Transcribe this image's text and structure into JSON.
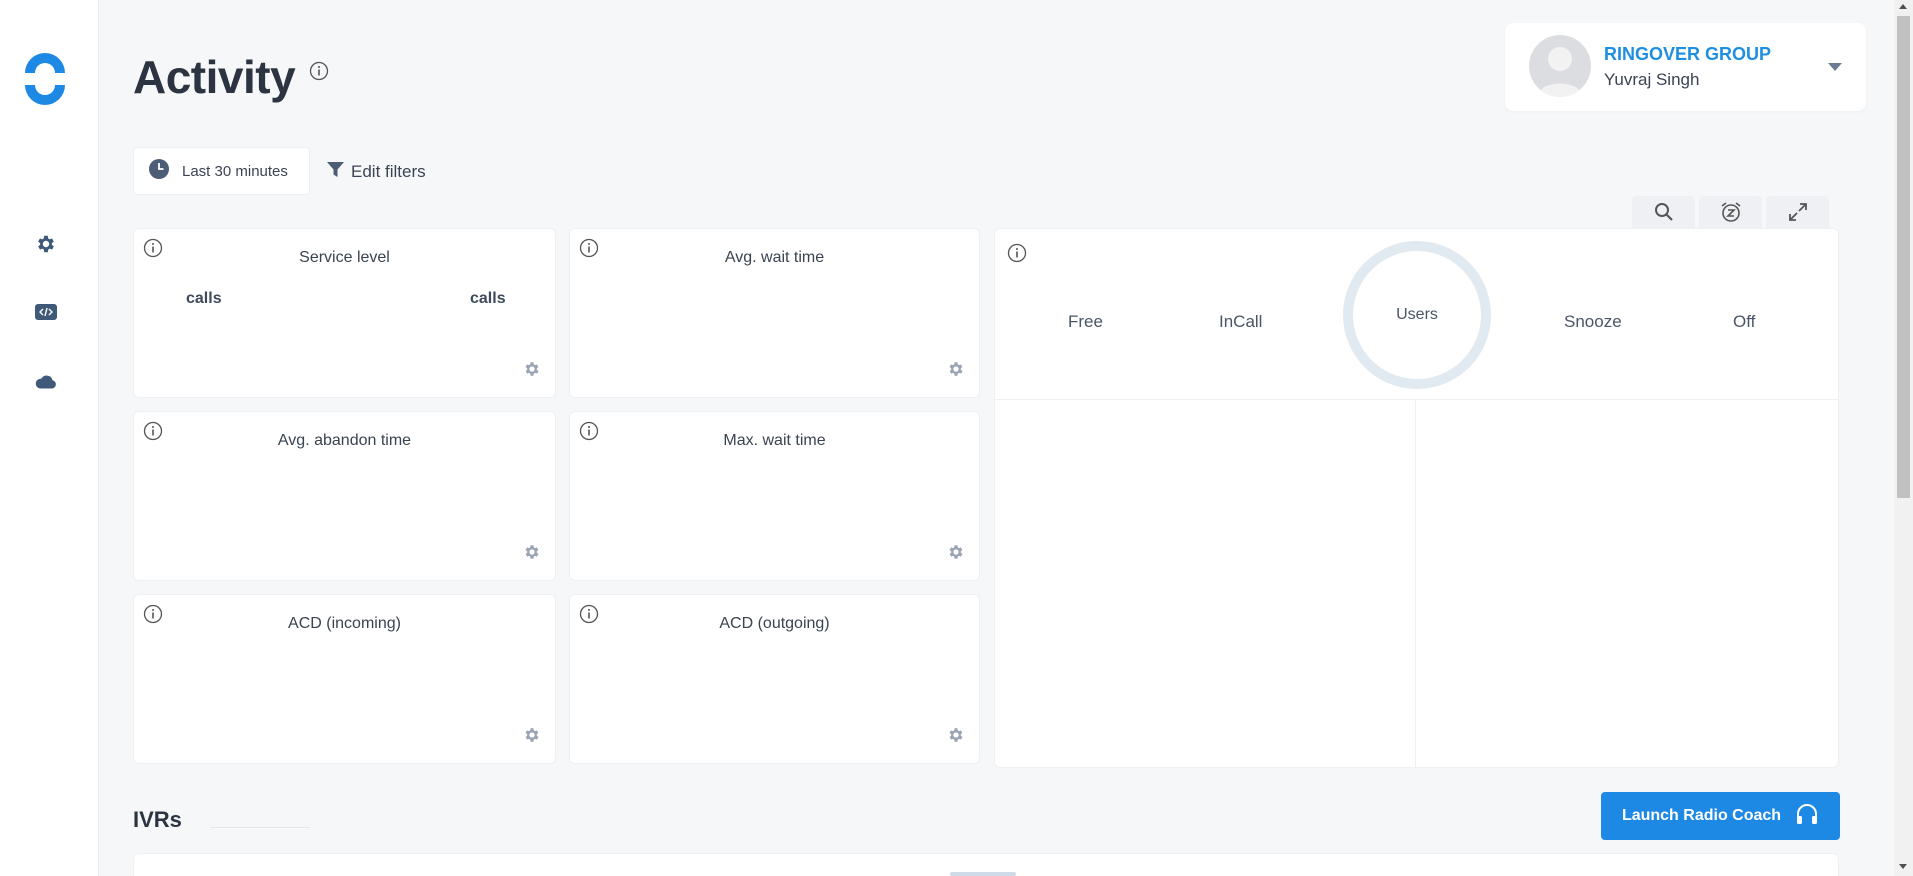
{
  "header": {
    "title": "Activity"
  },
  "user": {
    "company": "RINGOVER GROUP",
    "name": "Yuvraj Singh"
  },
  "filters": {
    "time_range": "Last 30 minutes",
    "edit_label": "Edit filters"
  },
  "toolbar": {
    "icons": [
      "search-icon",
      "snooze-alarm-icon",
      "expand-icon"
    ]
  },
  "sidebar": {
    "icons": [
      "logo",
      "gear-icon",
      "code-icon",
      "cloud-icon"
    ]
  },
  "cards": {
    "service_level": {
      "title": "Service level",
      "left_unit": "calls",
      "right_unit": "calls"
    },
    "avg_wait_time": {
      "title": "Avg. wait time"
    },
    "avg_abandon_time": {
      "title": "Avg. abandon time"
    },
    "max_wait_time": {
      "title": "Max. wait time"
    },
    "acd_incoming": {
      "title": "ACD (incoming)"
    },
    "acd_outgoing": {
      "title": "ACD (outgoing)"
    }
  },
  "status": {
    "free": "Free",
    "incall": "InCall",
    "users": "Users",
    "snooze": "Snooze",
    "off": "Off"
  },
  "ivrs": {
    "title": "IVRs"
  },
  "radio_coach": {
    "label": "Launch Radio Coach"
  },
  "colors": {
    "accent": "#1e88e5",
    "company_text": "#1e8fe0",
    "ring": "#e1e9f1"
  }
}
